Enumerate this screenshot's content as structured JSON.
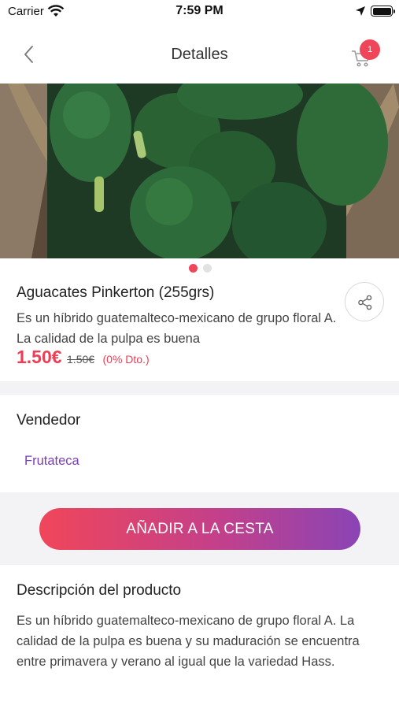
{
  "status_bar": {
    "carrier": "Carrier",
    "time": "7:59 PM"
  },
  "navbar": {
    "title": "Detalles",
    "cart_count": "1"
  },
  "product": {
    "name": "Aguacates Pinkerton (255grs)",
    "short_description": "Es  un híbrido guatemalteco-mexicano de grupo floral A. La calidad de la pulpa es buena",
    "price": "1.50€",
    "old_price": "1.50€",
    "discount": "(0% Dto.)",
    "image_count": 2,
    "active_image": 1
  },
  "seller": {
    "title": "Vendedor",
    "name": "Frutateca"
  },
  "actions": {
    "add_to_cart_label": "AÑADIR A LA CESTA"
  },
  "description": {
    "title": "Descripción del producto",
    "text": "Es  un híbrido guatemalteco-mexicano de grupo floral A. La calidad de la pulpa es buena y su maduración se encuentra entre primavera y verano al igual que la variedad Hass."
  },
  "colors": {
    "accent": "#f0465a",
    "purple": "#7a3fb0",
    "gradient_end": "#8a44b5"
  }
}
